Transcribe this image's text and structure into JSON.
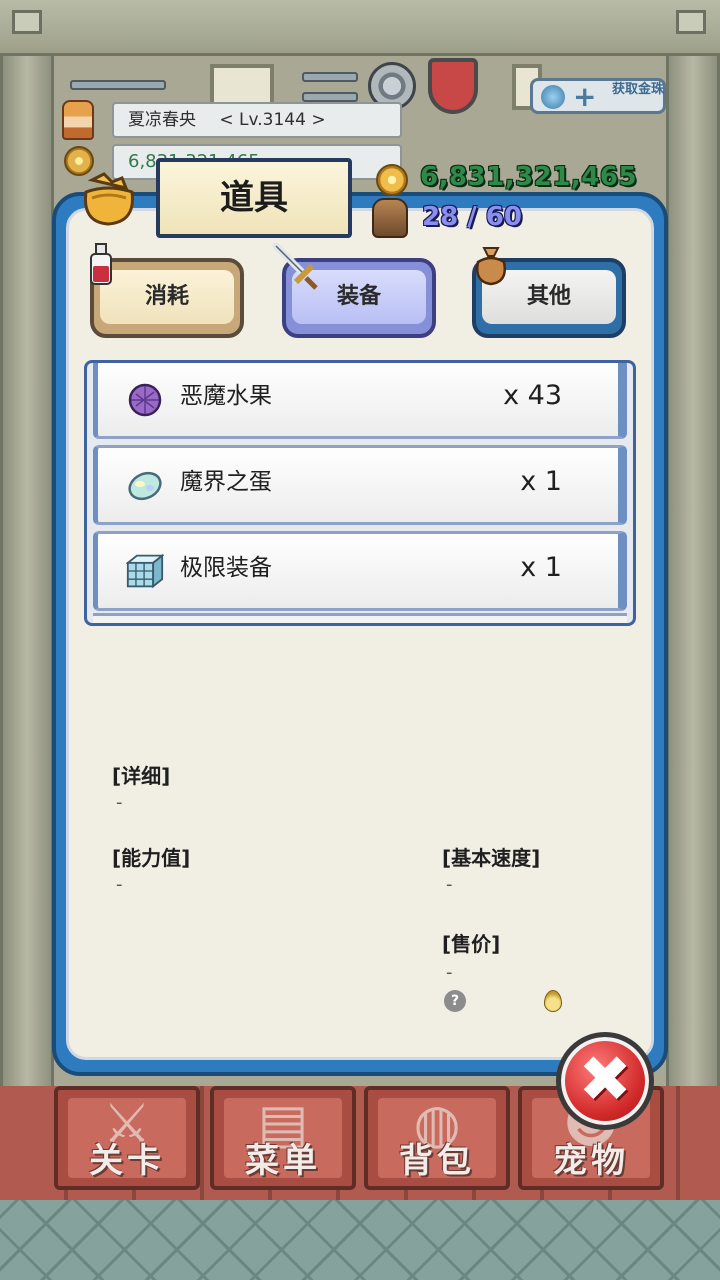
{
  "player": {
    "name": "夏凉春央",
    "level": "< Lv.3144 >",
    "gold_bg": "6,831,321,465"
  },
  "top_right": {
    "get_gold_label": "获取金珠"
  },
  "dialog": {
    "title": "道具",
    "gold": "6,831,321,465",
    "capacity": "28 / 60"
  },
  "categories": [
    {
      "label": "消耗",
      "selected": false
    },
    {
      "label": "装备",
      "selected": true
    },
    {
      "label": "其他",
      "selected": false
    }
  ],
  "items": [
    {
      "name": "恶魔水果",
      "qty": "x 43",
      "icon": "demon-fruit-icon"
    },
    {
      "name": "魔界之蛋",
      "qty": "x 1",
      "icon": "demon-egg-icon"
    },
    {
      "name": "极限装备",
      "qty": "x 1",
      "icon": "limit-equip-icon"
    }
  ],
  "details": {
    "detail_label": "[详细]",
    "detail_value": "-",
    "ability_label": "[能力值]",
    "ability_value": "-",
    "speed_label": "[基本速度]",
    "speed_value": "-",
    "price_label": "[售价]",
    "price_value": "-"
  },
  "nav": [
    {
      "label": "关卡",
      "icon": "crossed-swords-icon"
    },
    {
      "label": "菜单",
      "icon": "book-icon"
    },
    {
      "label": "背包",
      "icon": "backpack-icon"
    },
    {
      "label": "宠物",
      "icon": "pet-icon"
    }
  ],
  "colors": {
    "dialog_frame": "#2f7bc0",
    "gold_text": "#2f8a4a",
    "capacity_text": "#8a8ef0",
    "nav_button": "#a94d43",
    "close_button": "#d22a2a"
  }
}
